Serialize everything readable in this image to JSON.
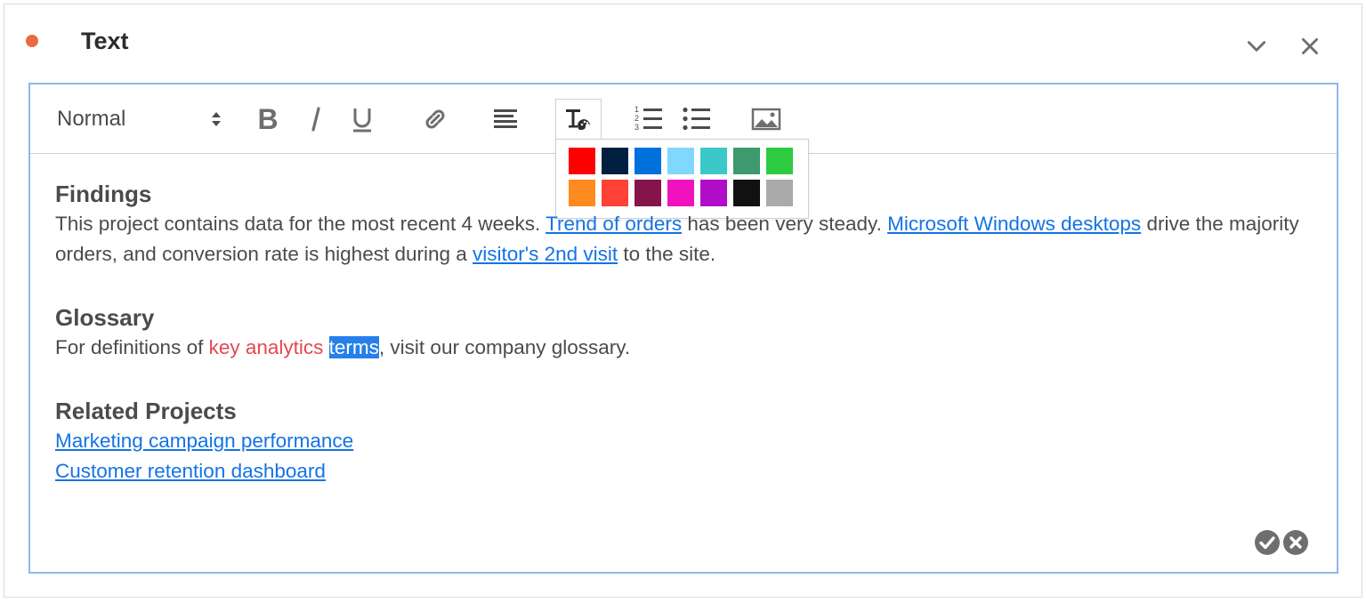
{
  "panel": {
    "title": "Text",
    "status_color": "#ea6b3f",
    "icons": {
      "collapse": "chevron-down-icon",
      "close": "close-icon"
    }
  },
  "toolbar": {
    "format_value": "Normal",
    "icons": [
      "bold-icon",
      "italic-icon",
      "underline-icon",
      "link-icon",
      "align-left-icon",
      "text-color-icon",
      "ordered-list-icon",
      "bulleted-list-icon",
      "image-icon"
    ]
  },
  "color_palette": {
    "row1": [
      "#ff0000",
      "#002040",
      "#0070dd",
      "#80d8ff",
      "#3cc8c8",
      "#3c9a6e",
      "#2ecc40"
    ],
    "row2": [
      "#ff8a1f",
      "#ff4136",
      "#85144b",
      "#f012be",
      "#b10dc9",
      "#111111",
      "#aaaaaa"
    ]
  },
  "content": {
    "findings": {
      "heading": "Findings",
      "t1": "This project contains data for the most recent 4 weeks. ",
      "l1": "Trend of orders",
      "t2": " has been very steady. ",
      "l2": "Microsoft Windows desktops",
      "t3": " drive the majority orders, and conversion rate is highest during a ",
      "l3": "visitor's 2nd visit",
      "t4": " to the site."
    },
    "glossary": {
      "heading": "Glossary",
      "t1": "For definitions of ",
      "red": "key analytics",
      "space": " ",
      "selected": "terms",
      "t2": ", visit our company glossary."
    },
    "related": {
      "heading": "Related Projects",
      "links": [
        "Marketing campaign performance",
        "Customer retention dashboard"
      ]
    }
  },
  "actions": {
    "confirm": "checkmark-circle-icon",
    "cancel": "cancel-circle-icon"
  }
}
